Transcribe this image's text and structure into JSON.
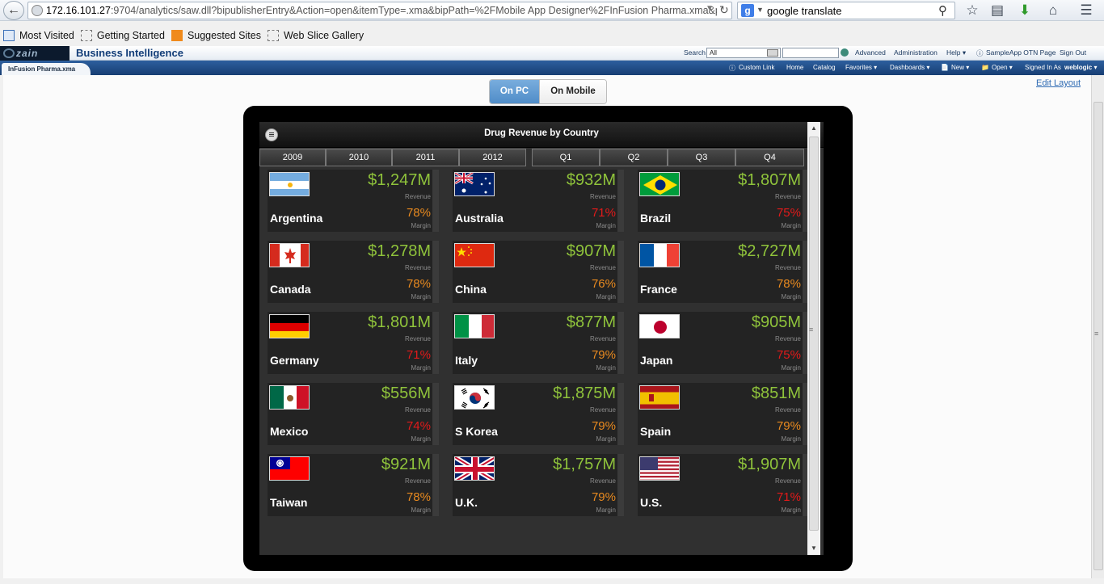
{
  "browser": {
    "url_host": "172.16.101.27",
    "url_path": ":9704/analytics/saw.dll?bipublisherEntry&Action=open&itemType=.xma&bipPath=%2FMobile App Designer%2FInFusion Pharma.xma&patl",
    "search_engine_icon": "g-logo-icon",
    "search_value": "google translate",
    "bookmarks": [
      {
        "label": "Most Visited",
        "icon": "most-visited-icon"
      },
      {
        "label": "Getting Started",
        "icon": "page-icon"
      },
      {
        "label": "Suggested Sites",
        "icon": "suggested-sites-icon"
      },
      {
        "label": "Web Slice Gallery",
        "icon": "page-icon"
      }
    ]
  },
  "obi": {
    "logo_text": "zain",
    "title": "Business Intelligence",
    "search_label": "Search",
    "search_scope": "All",
    "advanced": "Advanced",
    "administration": "Administration",
    "help": "Help ▾",
    "sampleapp": "SampleApp OTN Page",
    "signout": "Sign Out",
    "doc_tab": "InFusion Pharma.xma",
    "custom_link": "Custom Link",
    "home": "Home",
    "catalog": "Catalog",
    "favorites": "Favorites ▾",
    "dashboards": "Dashboards ▾",
    "new": "New ▾",
    "open": "Open ▾",
    "signed_in_as": "Signed In As",
    "user": "weblogic ▾"
  },
  "view": {
    "on_pc": "On PC",
    "on_mobile": "On Mobile",
    "edit_layout": "Edit Layout"
  },
  "app": {
    "title": "Drug Revenue by Country",
    "years": [
      "2009",
      "2010",
      "2011",
      "2012"
    ],
    "quarters": [
      "Q1",
      "Q2",
      "Q3",
      "Q4"
    ],
    "revenue_label": "Revenue",
    "margin_label": "Margin",
    "colors": {
      "revenue": "#8fc33b",
      "margin_orange": "#e98a1f",
      "margin_red": "#e21a1a"
    },
    "tiles": [
      {
        "country": "Argentina",
        "revenue": "$1,247M",
        "margin": "78%",
        "margin_color": "orange",
        "flag": "argentina-flag-icon"
      },
      {
        "country": "Australia",
        "revenue": "$932M",
        "margin": "71%",
        "margin_color": "red",
        "flag": "australia-flag-icon"
      },
      {
        "country": "Brazil",
        "revenue": "$1,807M",
        "margin": "75%",
        "margin_color": "red",
        "flag": "brazil-flag-icon"
      },
      {
        "country": "Canada",
        "revenue": "$1,278M",
        "margin": "78%",
        "margin_color": "orange",
        "flag": "canada-flag-icon"
      },
      {
        "country": "China",
        "revenue": "$907M",
        "margin": "76%",
        "margin_color": "orange",
        "flag": "china-flag-icon"
      },
      {
        "country": "France",
        "revenue": "$2,727M",
        "margin": "78%",
        "margin_color": "orange",
        "flag": "france-flag-icon"
      },
      {
        "country": "Germany",
        "revenue": "$1,801M",
        "margin": "71%",
        "margin_color": "red",
        "flag": "germany-flag-icon"
      },
      {
        "country": "Italy",
        "revenue": "$877M",
        "margin": "79%",
        "margin_color": "orange",
        "flag": "italy-flag-icon"
      },
      {
        "country": "Japan",
        "revenue": "$905M",
        "margin": "75%",
        "margin_color": "red",
        "flag": "japan-flag-icon"
      },
      {
        "country": "Mexico",
        "revenue": "$556M",
        "margin": "74%",
        "margin_color": "red",
        "flag": "mexico-flag-icon"
      },
      {
        "country": "S Korea",
        "revenue": "$1,875M",
        "margin": "79%",
        "margin_color": "orange",
        "flag": "south-korea-flag-icon"
      },
      {
        "country": "Spain",
        "revenue": "$851M",
        "margin": "79%",
        "margin_color": "orange",
        "flag": "spain-flag-icon"
      },
      {
        "country": "Taiwan",
        "revenue": "$921M",
        "margin": "78%",
        "margin_color": "orange",
        "flag": "taiwan-flag-icon"
      },
      {
        "country": "U.K.",
        "revenue": "$1,757M",
        "margin": "79%",
        "margin_color": "orange",
        "flag": "uk-flag-icon"
      },
      {
        "country": "U.S.",
        "revenue": "$1,907M",
        "margin": "71%",
        "margin_color": "red",
        "flag": "us-flag-icon"
      }
    ]
  }
}
